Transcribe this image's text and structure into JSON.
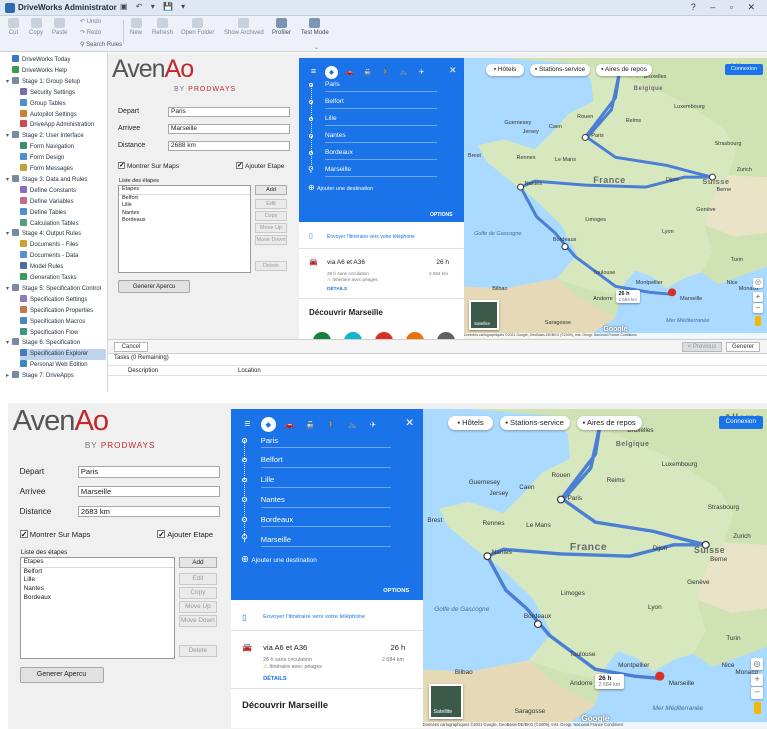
{
  "window": {
    "title": "DriveWorks Administrator",
    "controls": "? – ▫ ✕"
  },
  "ribbon": {
    "cut": "Cut",
    "copy": "Copy",
    "paste": "Paste",
    "undo": "Undo",
    "redo": "Redo",
    "search_rules": "Search Rules",
    "new": "New",
    "refresh": "Refresh",
    "open_folder": "Open Folder",
    "show_archived": "Show Archived",
    "profiler": "Profiler",
    "test_mode": "Test Mode"
  },
  "tree": [
    {
      "label": "DriveWorks Today",
      "level": 0,
      "color": "#3b78c2"
    },
    {
      "label": "DriveWorks Help",
      "level": 0,
      "color": "#3b9c4a"
    },
    {
      "label": "Stage 1: Group Setup",
      "level": 0,
      "color": "#7b8aa3",
      "expander": "▾"
    },
    {
      "label": "Security Settings",
      "level": 1,
      "color": "#7a6cb0"
    },
    {
      "label": "Group Tables",
      "level": 1,
      "color": "#4f8fcf"
    },
    {
      "label": "Autopilot Settings",
      "level": 1,
      "color": "#d07f2e"
    },
    {
      "label": "DriveApp Administration",
      "level": 1,
      "color": "#d14a4a"
    },
    {
      "label": "Stage 2: User Interface",
      "level": 0,
      "color": "#7b8aa3",
      "expander": "▾"
    },
    {
      "label": "Form Navigation",
      "level": 1,
      "color": "#3a8c6a"
    },
    {
      "label": "Form Design",
      "level": 1,
      "color": "#4f8fcf"
    },
    {
      "label": "Form Messages",
      "level": 1,
      "color": "#c3a03a"
    },
    {
      "label": "Stage 3: Data and Rules",
      "level": 0,
      "color": "#7b8aa3",
      "expander": "▾"
    },
    {
      "label": "Define Constants",
      "level": 1,
      "color": "#8a6cc0"
    },
    {
      "label": "Define Variables",
      "level": 1,
      "color": "#c06c8a"
    },
    {
      "label": "Define Tables",
      "level": 1,
      "color": "#4f8fcf"
    },
    {
      "label": "Calculation Tables",
      "level": 1,
      "color": "#4fa07a"
    },
    {
      "label": "Stage 4: Output Rules",
      "level": 0,
      "color": "#7b8aa3",
      "expander": "▾"
    },
    {
      "label": "Documents - Files",
      "level": 1,
      "color": "#d0a030"
    },
    {
      "label": "Documents - Data",
      "level": 1,
      "color": "#5a8fd0"
    },
    {
      "label": "Model Rules",
      "level": 1,
      "color": "#4a6fa0"
    },
    {
      "label": "Generation Tasks",
      "level": 1,
      "color": "#3a9a5a"
    },
    {
      "label": "Stage 5: Specification Control",
      "level": 0,
      "color": "#7b8aa3",
      "expander": "▾"
    },
    {
      "label": "Specification Settings",
      "level": 1,
      "color": "#8a7cc0"
    },
    {
      "label": "Specification Properties",
      "level": 1,
      "color": "#c07a4a"
    },
    {
      "label": "Specification Macros",
      "level": 1,
      "color": "#4a8ac0"
    },
    {
      "label": "Specification Flow",
      "level": 1,
      "color": "#3a9a7a"
    },
    {
      "label": "Stage 6: Specification",
      "level": 0,
      "color": "#7b8aa3",
      "expander": "▾"
    },
    {
      "label": "Specification Explorer",
      "level": 1,
      "color": "#4a7ac0",
      "selected": true
    },
    {
      "label": "Personal Web Edition",
      "level": 1,
      "color": "#3a8ac0"
    },
    {
      "label": "Stage 7: DriveApps",
      "level": 0,
      "color": "#7b8aa3",
      "expander": "▸"
    }
  ],
  "form": {
    "logo_main_prefix": "Aven",
    "logo_main_suffix": "Ao",
    "logo_sub_prefix": "BY ",
    "logo_sub_brand": "PRODWAYS",
    "depart_label": "Depart",
    "depart_value": "Paris",
    "arrivee_label": "Arrivee",
    "arrivee_value": "Marseille",
    "distance_label": "Distance",
    "distance_value_top": "2688 km",
    "distance_value_bottom": "2683 km",
    "show_maps_label": "Montrer Sur Maps",
    "add_step_label": "Ajouter Etape",
    "list_caption": "Liste des étapes",
    "list_header": "Etapes",
    "list_items": [
      "Belfort",
      "Lille",
      "Nantes",
      "Bordeaux"
    ],
    "btn_add": "Add",
    "btn_edit": "Edit",
    "btn_copy": "Copy",
    "btn_move_up": "Move Up",
    "btn_move_down": "Move Down",
    "btn_delete": "Delete",
    "btn_generate": "Generer Apercu"
  },
  "directions": {
    "waypoints": [
      "Paris",
      "Belfort",
      "Lille",
      "Nantes",
      "Bordeaux",
      "Marseille"
    ],
    "add_destination": "Ajouter une destination",
    "options": "OPTIONS",
    "send_to_phone": "Envoyer l'itinéraire vers votre téléphone",
    "route_via": "via A6 et A36",
    "route_time": "26 h",
    "route_traffic": "26 h sans circulation",
    "route_distance": "2 684 km",
    "route_warning": "Itinéraire avec péages",
    "route_details": "DÉTAILS",
    "discover": "Découvrir Marseille",
    "close": "✕",
    "menu": "≡"
  },
  "map": {
    "chip_hotels": "Hôtels",
    "chip_stations": "Stations-service",
    "chip_rest": "Aires de repos",
    "connect": "Connexion",
    "satellite": "Satellite",
    "attribution": "Données cartographiques ©2021 Google, GeoBasis-DE/BKG (©2009), Inst. Geogr. Nacional   France   Conditions",
    "google": "Google",
    "duration_time": "26 h",
    "duration_dist": "2 684 km",
    "labels": {
      "france": "France",
      "allemagne": "Allema",
      "suisse": "Suisse",
      "jersey": "Jersey",
      "guernesey": "Guernesey",
      "paris": "Paris",
      "lille": "Lille",
      "bruxelles": "Bruxelles",
      "belgique": "Belgique",
      "luxembourg": "Luxembourg",
      "strasbourg": "Strasbourg",
      "nantes": "Nantes",
      "lyon": "Lyon",
      "bordeaux": "Bordeaux",
      "toulouse": "Toulouse",
      "montpellier": "Montpellier",
      "marseille": "Marseille",
      "andorre": "Andorre",
      "bilbao": "Bilbao",
      "saragosse": "Saragosse",
      "turin": "Turin",
      "monaco": "Monaco",
      "dijon": "Dijon",
      "le_mans": "Le Mans",
      "rennes": "Rennes",
      "caen": "Caen",
      "rouen": "Rouen",
      "reims": "Reims",
      "brest": "Brest",
      "limoges": "Limoges",
      "geneve": "Genève",
      "berne": "Berne",
      "zurich": "Zurich",
      "nice": "Nice",
      "golfe": "Golfe de Gascogne",
      "mer": "Mer Méditerranée"
    }
  },
  "navbar": {
    "cancel": "Cancel",
    "previous": "< Previous",
    "generate": "Generer"
  },
  "tasks": {
    "caption": "Tasks (0 Remaining)",
    "col_description": "Description",
    "col_location": "Location"
  },
  "colors": {
    "google_blue": "#1a73e8",
    "route_blue": "#4a7fd4",
    "pin_red": "#d93025",
    "brand_red": "#c1272d"
  }
}
